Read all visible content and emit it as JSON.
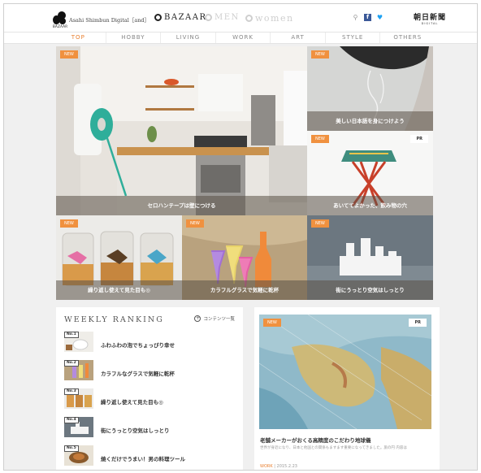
{
  "header": {
    "logo_caption": "BAZAAR",
    "site_name": "Asahi Shimbun Digital［and］",
    "brands": [
      {
        "label": "BAZAAR",
        "active": true
      },
      {
        "label": "MEN",
        "active": false
      },
      {
        "label": "women",
        "active": false
      }
    ],
    "social_icons": [
      "search-icon",
      "facebook-icon",
      "twitter-icon"
    ],
    "newspaper": {
      "main": "朝日新聞",
      "sub": "DIGITAL"
    }
  },
  "nav": {
    "items": [
      "TOP",
      "HOBBY",
      "LIVING",
      "WORK",
      "ART",
      "STYLE",
      "OTHERS"
    ],
    "active_index": 0
  },
  "tiles": [
    {
      "badge": "NEW",
      "caption": "セロハンテープは壁につける",
      "pr": ""
    },
    {
      "badge": "NEW",
      "caption": "美しい日本語を身につけよう",
      "pr": ""
    },
    {
      "badge": "NEW",
      "caption": "あいててよかった、飲み物の穴",
      "pr": "PR"
    },
    {
      "badge": "NEW",
      "caption": "繰り返し使えて見た目も◎",
      "pr": ""
    },
    {
      "badge": "NEW",
      "caption": "カラフルグラスで気軽に乾杯",
      "pr": ""
    },
    {
      "badge": "NEW",
      "caption": "街にうっとり空気はしっとり",
      "pr": ""
    }
  ],
  "ranking": {
    "title": "WEEKLY RANKING",
    "link": "コンテンツ一覧",
    "items": [
      {
        "no": "No.1",
        "text": "ふわふわの泡でちょっぴり幸せ"
      },
      {
        "no": "No.2",
        "text": "カラフルなグラスで気軽に乾杯"
      },
      {
        "no": "No.3",
        "text": "繰り返し使えて見た目も◎"
      },
      {
        "no": "No.4",
        "text": "街にうっとり空気はしっとり"
      },
      {
        "no": "No.5",
        "text": "焼くだけでうまい！男の料理ツール"
      }
    ]
  },
  "feature": {
    "badge": "NEW",
    "pr": "PR",
    "title": "老舗メーカーがおくる高精度のこだわり地球儀",
    "description": "世界が身近になり、日本と他国との関係もますます重要になってきました。旅の円 内容は",
    "category": "WORK",
    "date": "2015.2.23"
  },
  "colors": {
    "accent": "#e87f2f",
    "badge": "#f0913f",
    "background": "#f0f0f0"
  }
}
